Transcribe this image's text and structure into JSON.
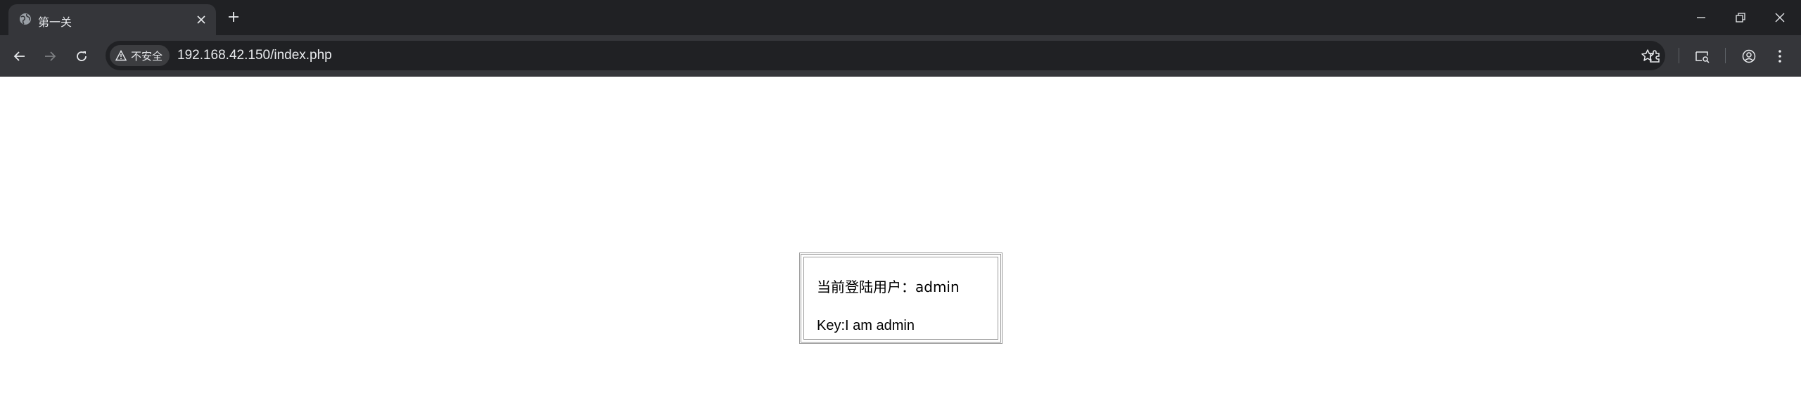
{
  "browser": {
    "tab": {
      "title": "第一关"
    },
    "address": {
      "security_label": "不安全",
      "url": "192.168.42.150/index.php"
    }
  },
  "page": {
    "current_user_label": "当前登陆用户：admin",
    "key_text": "Key:I am admin"
  },
  "colors": {
    "tabstrip_bg": "#202124",
    "toolbar_bg": "#35363a",
    "omnibox_bg": "#202124",
    "icon": "#e8eaed",
    "icon_disabled": "#7d7f82",
    "border": "#9a9a9a"
  },
  "icons": [
    "globe-icon",
    "close-icon",
    "plus-icon",
    "minimize-icon",
    "restore-icon",
    "window-close-icon",
    "back-arrow-icon",
    "forward-arrow-icon",
    "reload-icon",
    "warning-icon",
    "star-icon",
    "extensions-icon",
    "media-control-icon",
    "profile-icon",
    "menu-dots-icon"
  ]
}
